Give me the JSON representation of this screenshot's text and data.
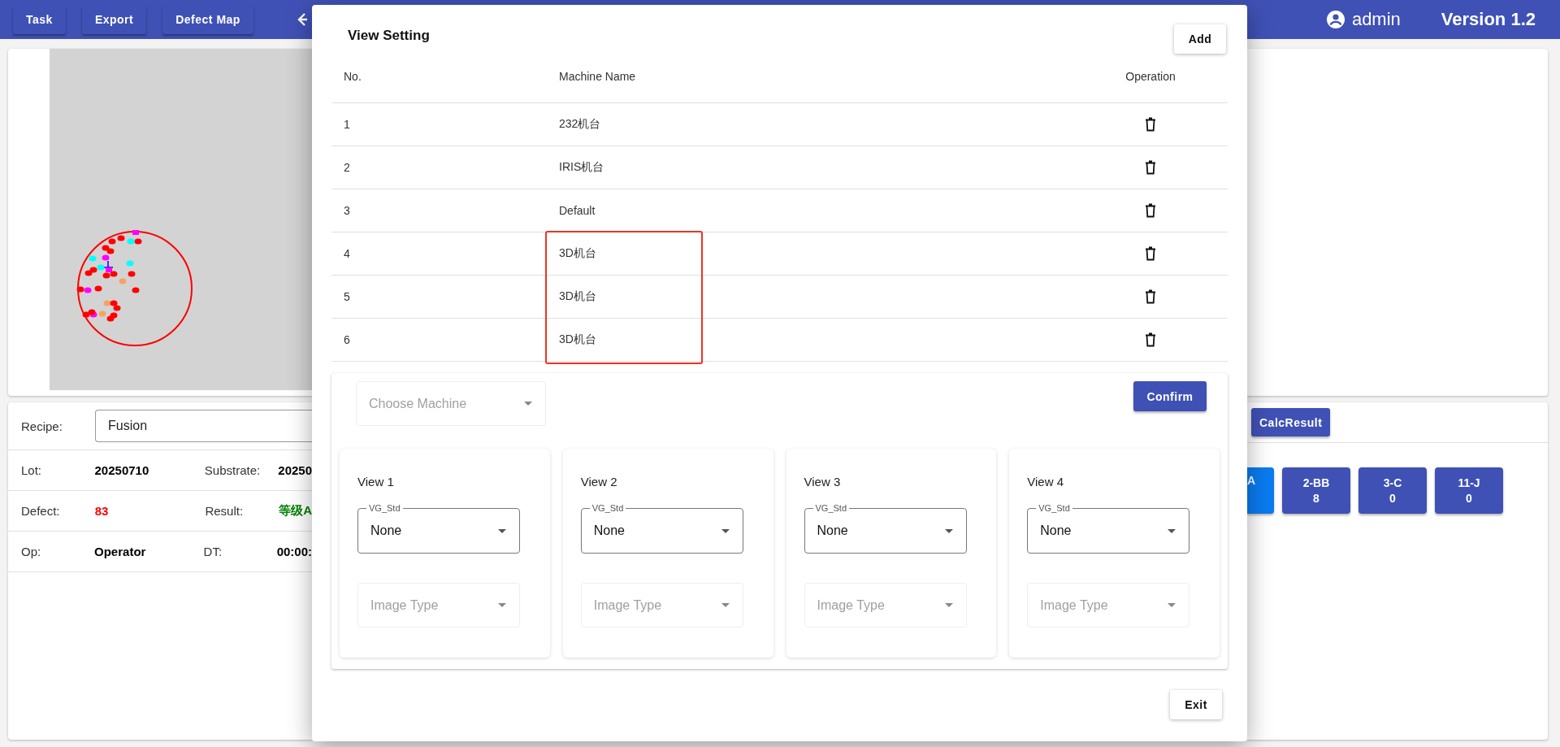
{
  "toolbar": {
    "buttons": [
      "Task",
      "Export",
      "Defect Map"
    ],
    "user": "admin",
    "version": "Version 1.2"
  },
  "recipe": {
    "label": "Recipe:",
    "value": "Fusion"
  },
  "info_rows": [
    {
      "fields": [
        {
          "label": "Lot:",
          "value": "20250710",
          "color": "#000000"
        },
        {
          "label": "Substrate:",
          "value": "20250",
          "color": "#000000"
        }
      ]
    },
    {
      "fields": [
        {
          "label": "Defect:",
          "value": "83",
          "color": "#ff0000"
        },
        {
          "label": "Result:",
          "value": "等级A",
          "color": "#008000"
        }
      ]
    },
    {
      "fields": [
        {
          "label": "Op:",
          "value": "Operator",
          "color": "#000000"
        },
        {
          "label": "DT:",
          "value": "00:00:",
          "color": "#000000"
        }
      ]
    }
  ],
  "calc_button": "CalcResult",
  "grades": [
    {
      "label": "A",
      "selected": true
    },
    {
      "label": "2-BB",
      "count": "8",
      "selected": false
    },
    {
      "label": "3-C",
      "count": "0",
      "selected": false
    },
    {
      "label": "11-J",
      "count": "0",
      "selected": false
    }
  ],
  "dialog": {
    "title": "View Setting",
    "add_button": "Add",
    "columns": [
      "No.",
      "Machine Name",
      "Operation"
    ],
    "rows": [
      {
        "no": "1",
        "name": "232机台",
        "highlighted": false
      },
      {
        "no": "2",
        "name": "IRIS机台",
        "highlighted": false
      },
      {
        "no": "3",
        "name": "Default",
        "highlighted": false
      },
      {
        "no": "4",
        "name": "3D机台",
        "highlighted": true
      },
      {
        "no": "5",
        "name": "3D机台",
        "highlighted": true
      },
      {
        "no": "6",
        "name": "3D机台",
        "highlighted": true
      }
    ],
    "machine_select": {
      "placeholder": "Choose Machine",
      "disabled": true
    },
    "confirm_button": "Confirm",
    "views": [
      {
        "title": "View 1",
        "select_label": "VG_Std",
        "value": "None",
        "image_type": {
          "placeholder": "Image Type",
          "disabled": true
        }
      },
      {
        "title": "View 2",
        "select_label": "VG_Std",
        "value": "None",
        "image_type": {
          "placeholder": "Image Type",
          "disabled": true
        }
      },
      {
        "title": "View 3",
        "select_label": "VG_Std",
        "value": "None",
        "image_type": {
          "placeholder": "Image Type",
          "disabled": true
        }
      },
      {
        "title": "View 4",
        "select_label": "VG_Std",
        "value": "None",
        "image_type": {
          "placeholder": "Image Type",
          "disabled": true
        }
      }
    ],
    "exit_button": "Exit"
  }
}
